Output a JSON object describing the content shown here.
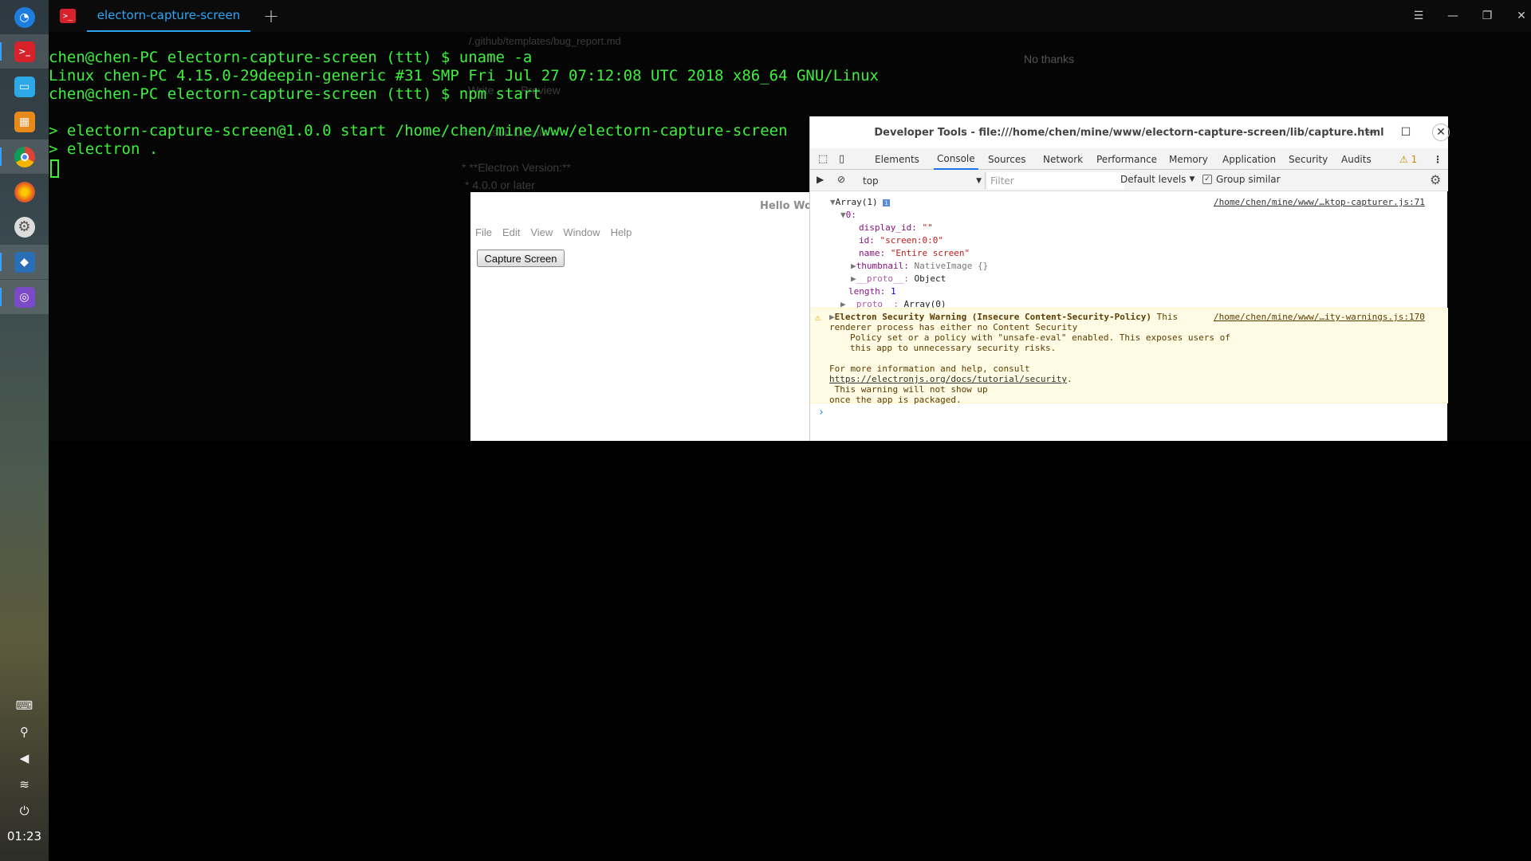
{
  "dock": {
    "items": [
      {
        "name": "deepin-launcher",
        "glyph": "◔",
        "color": "#1e7ee0"
      },
      {
        "name": "terminal",
        "glyph": ">_",
        "color": "#d8222b"
      },
      {
        "name": "file-manager",
        "glyph": "▭",
        "color": "#2da8e6"
      },
      {
        "name": "app-store",
        "glyph": "▦",
        "color": "#e88a1a"
      },
      {
        "name": "chrome",
        "glyph": "●",
        "color": "#e0b32a"
      },
      {
        "name": "firefox",
        "glyph": "◉",
        "color": "#e8601c"
      },
      {
        "name": "settings",
        "glyph": "⚙",
        "color": "#555"
      },
      {
        "name": "vscode",
        "glyph": "◆",
        "color": "#2a6fb5"
      },
      {
        "name": "capture-app",
        "glyph": "◎",
        "color": "#7a4ac8"
      }
    ],
    "tray": {
      "keyboard": "⌨",
      "usb": "⚲",
      "volume": "🔈",
      "wifi": "≋",
      "power": "⏻"
    },
    "clock": "01:23"
  },
  "terminal": {
    "tab_title": "electorn-capture-screen",
    "new_tab": "+",
    "lines": [
      "chen@chen-PC electorn-capture-screen (ttt) $ uname -a",
      "Linux chen-PC 4.15.0-29deepin-generic #31 SMP Fri Jul 27 07:12:08 UTC 2018 x86_64 GNU/Linux",
      "chen@chen-PC electorn-capture-screen (ttt) $ npm start",
      "",
      "> electorn-capture-screen@1.0.0 start /home/chen/mine/www/electorn-capture-screen",
      "> electron ."
    ]
  },
  "ghost": {
    "no_thanks": "No thanks",
    "write": "Write",
    "preview": "Preview",
    "issue_details": "### Issue Details",
    "electron_version": "* **Electron Version:**",
    "version_value": "* 4.0.0 or later",
    "template_path": "/.github/templates/bug_report.md"
  },
  "app": {
    "title": "Hello World!",
    "menu": [
      "File",
      "Edit",
      "View",
      "Window",
      "Help"
    ],
    "button": "Capture Screen"
  },
  "devtools": {
    "title": "Developer Tools - file:///home/chen/mine/www/electorn-capture-screen/lib/capture.html",
    "tabs": [
      "Elements",
      "Console",
      "Sources",
      "Network",
      "Performance",
      "Memory",
      "Application",
      "Security",
      "Audits"
    ],
    "active_tab": "Console",
    "warning_count": "1",
    "context": "top",
    "filter_placeholder": "Filter",
    "levels": "Default levels",
    "group_similar": "Group similar",
    "console": {
      "array_label": "Array(1)",
      "src1": "/home/chen/mine/www/…ktop-capturer.js:71",
      "index": "0:",
      "display_id_key": "display_id:",
      "display_id_val": "\"\"",
      "id_key": "id:",
      "id_val": "\"screen:0:0\"",
      "name_key": "name:",
      "name_val": "\"Entire screen\"",
      "thumb_key": "thumbnail:",
      "thumb_val": "NativeImage {}",
      "proto_key": "__proto__:",
      "proto_val": "Object",
      "length_key": "length:",
      "length_val": "1",
      "proto2_val": "Array(0)",
      "warn_title": "Electron Security Warning (Insecure Content-Security-Policy)",
      "warn_l1": "This",
      "warn_l2": "renderer process has either no Content Security",
      "warn_l3": "Policy set or a policy with \"unsafe-eval\" enabled. This exposes users of",
      "warn_l4": "this app to unnecessary security risks.",
      "warn_l5": "For more information and help, consult",
      "warn_link": "https://electronjs.org/docs/tutorial/security",
      "warn_l6": " This warning will not show up",
      "warn_l7": "once the app is packaged.",
      "src2": "/home/chen/mine/www/…ity-warnings.js:170"
    }
  },
  "colors": {
    "terminal_green": "#3cf03c",
    "tab_blue": "#2ca7f8",
    "warning_bg": "#fffbe5"
  }
}
